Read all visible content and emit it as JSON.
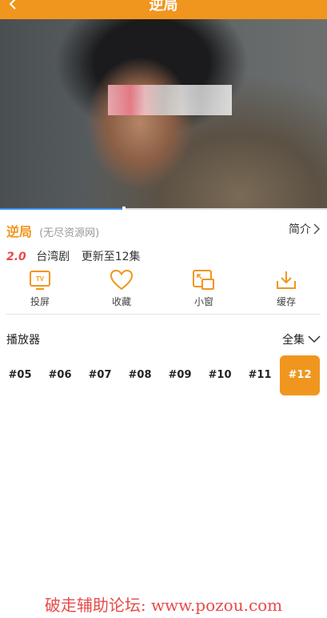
{
  "header": {
    "title": "逆局"
  },
  "video": {
    "progress": 0.38
  },
  "show": {
    "name": "逆局",
    "source": "(无尽资源网)",
    "intro_label": "简介",
    "score": "2.0",
    "region": "台湾剧",
    "update": "更新至12集"
  },
  "actions": [
    {
      "label": "投屏",
      "icon": "tv-icon"
    },
    {
      "label": "收藏",
      "icon": "heart-icon"
    },
    {
      "label": "小窗",
      "icon": "picture-in-picture-icon"
    },
    {
      "label": "缓存",
      "icon": "download-icon"
    }
  ],
  "player": {
    "label": "播放器",
    "all_label": "全集"
  },
  "episodes": [
    "#05",
    "#06",
    "#07",
    "#08",
    "#09",
    "#10",
    "#11",
    "#12"
  ],
  "active_episode": "#12",
  "watermark": "破走辅助论坛: www.pozou.com",
  "colors": {
    "accent": "#f0961e",
    "score": "#e84a4a",
    "progress": "#3b8ff0"
  }
}
